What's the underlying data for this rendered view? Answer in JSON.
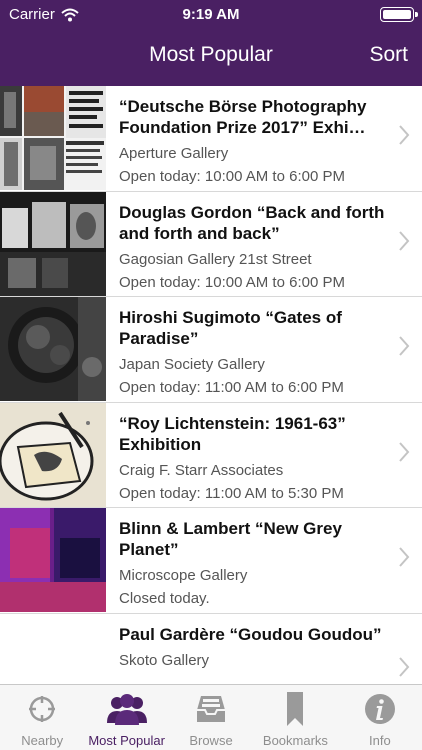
{
  "status_bar": {
    "carrier": "Carrier",
    "time": "9:19 AM"
  },
  "nav": {
    "title": "Most Popular",
    "sort_label": "Sort"
  },
  "exhibitions": [
    {
      "title": "“Deutsche Börse Photography Foundation Prize 2017” Exhi…",
      "gallery": "Aperture Gallery",
      "hours": "Open today: 10:00 AM to 6:00 PM"
    },
    {
      "title": "Douglas Gordon “Back and forth and forth and back”",
      "gallery": "Gagosian Gallery 21st Street",
      "hours": "Open today: 10:00 AM to 6:00 PM"
    },
    {
      "title": "Hiroshi Sugimoto “Gates of Paradise”",
      "gallery": "Japan Society Gallery",
      "hours": "Open today: 11:00 AM to 6:00 PM"
    },
    {
      "title": "“Roy Lichtenstein: 1961-63” Exhibition",
      "gallery": "Craig F. Starr Associates",
      "hours": "Open today: 11:00 AM to 5:30 PM"
    },
    {
      "title": "Blinn & Lambert “New Grey Planet”",
      "gallery": "Microscope Gallery",
      "hours": "Closed today."
    },
    {
      "title": "Paul Gardère “Goudou Goudou”",
      "gallery": "Skoto Gallery",
      "hours": ""
    }
  ],
  "tabs": [
    {
      "label": "Nearby",
      "icon": "crosshair-icon"
    },
    {
      "label": "Most Popular",
      "icon": "people-icon",
      "active": true
    },
    {
      "label": "Browse",
      "icon": "tray-icon"
    },
    {
      "label": "Bookmarks",
      "icon": "bookmark-icon"
    },
    {
      "label": "Info",
      "icon": "info-icon"
    }
  ],
  "colors": {
    "accent": "#4a2063",
    "tab_inactive": "#8e8e8e"
  }
}
